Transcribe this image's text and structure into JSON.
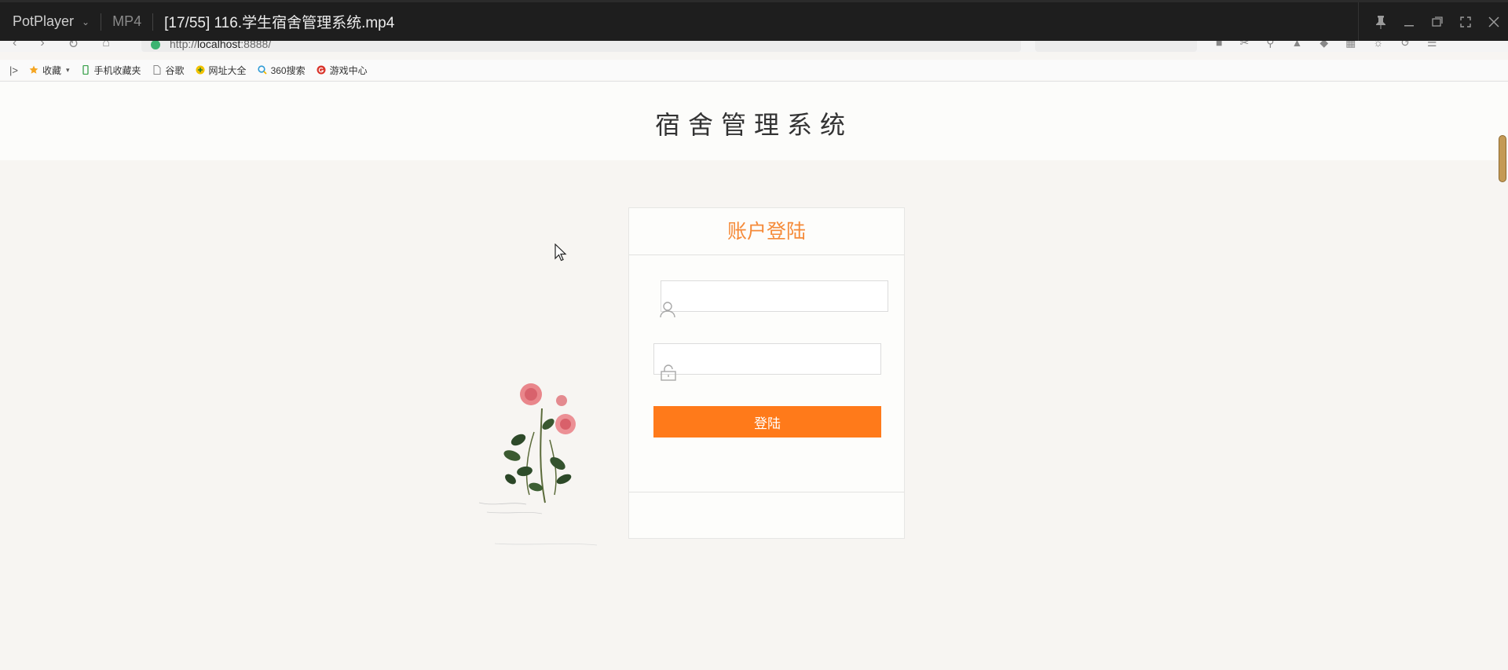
{
  "player": {
    "app_name": "PotPlayer",
    "format": "MP4",
    "file_title": "[17/55] 116.学生宿舍管理系统.mp4"
  },
  "browser": {
    "url": "http://localhost:8888/",
    "url_host": "localhost",
    "url_prefix": "http://",
    "url_suffix": ":8888/"
  },
  "bookmarks": {
    "items": [
      {
        "label": "收藏",
        "icon": "star-icon"
      },
      {
        "label": "手机收藏夹",
        "icon": "phone-icon"
      },
      {
        "label": "谷歌",
        "icon": "page-icon"
      },
      {
        "label": "网址大全",
        "icon": "globe-icon"
      },
      {
        "label": "360搜索",
        "icon": "search-360-icon"
      },
      {
        "label": "游戏中心",
        "icon": "game-icon"
      }
    ]
  },
  "page": {
    "title": "宿舍管理系统"
  },
  "login": {
    "heading": "账户登陆",
    "username_value": "",
    "password_value": "",
    "button_label": "登陆"
  },
  "colors": {
    "accent": "#ff7a1a",
    "heading": "#f58b3a",
    "page_bg": "#f7f5f2"
  }
}
